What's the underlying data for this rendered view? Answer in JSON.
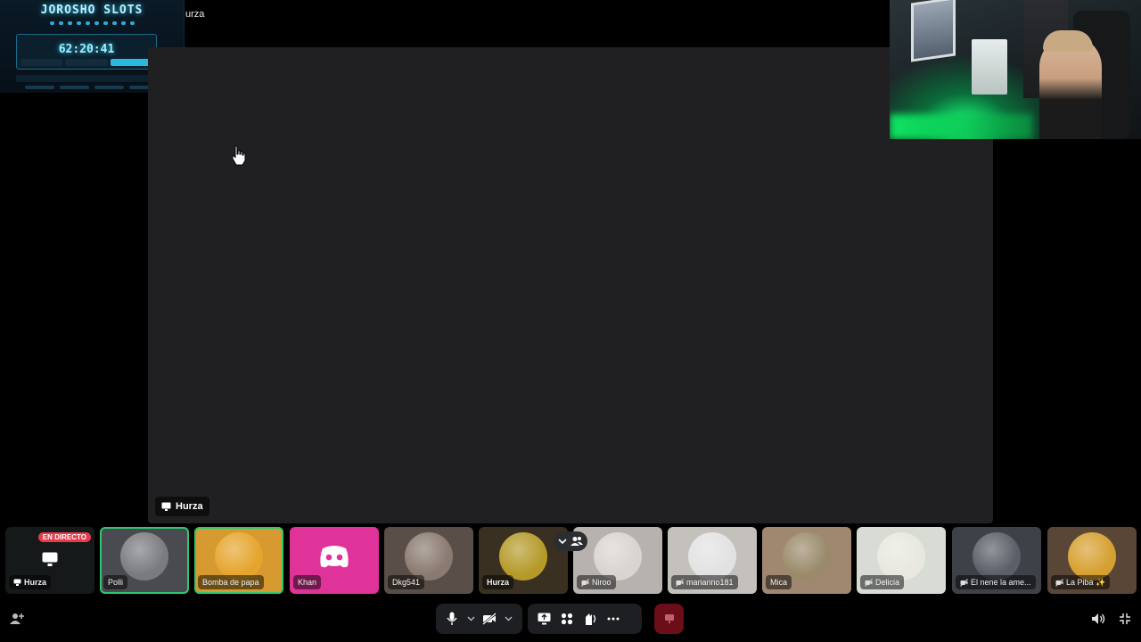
{
  "overlay": {
    "title": "JOROSHO SLOTS",
    "timer": "62:20:41"
  },
  "window": {
    "title": "urza"
  },
  "stage": {
    "streamer_name": "Hurza"
  },
  "participants": [
    {
      "name": "Hurza",
      "live": true,
      "live_label": "EN DIRECTO",
      "avatar_color": "#1a2a26",
      "tile_color": "#15191a"
    },
    {
      "name": "Polli",
      "avatar_color": "#7a7b80",
      "tile_color": "#4a4b50",
      "speaking": true
    },
    {
      "name": "Bomba de papa",
      "avatar_color": "#e5a52d",
      "tile_color": "#d69a30",
      "speaking": true
    },
    {
      "name": "Khan",
      "avatar_color": "#e6399b",
      "tile_color": "#e0339a"
    },
    {
      "name": "Dkg541",
      "avatar_color": "#8a7a70",
      "tile_color": "#5a4e48"
    },
    {
      "name": "Hurza",
      "avatar_color": "#b59a2a",
      "tile_color": "#3a3022"
    },
    {
      "name": "Niroo",
      "muted": true,
      "avatar_color": "#d8d4d0",
      "tile_color": "#b8b2ae"
    },
    {
      "name": "marianno181",
      "muted": true,
      "avatar_color": "#e2e2e2",
      "tile_color": "#c4c0bc"
    },
    {
      "name": "Mica",
      "avatar_color": "#9a8a6a",
      "tile_color": "#a08870"
    },
    {
      "name": "Delicia",
      "muted": true,
      "avatar_color": "#e8e8e0",
      "tile_color": "#d8dcd4"
    },
    {
      "name": "El nene la ame...",
      "muted": true,
      "avatar_color": "#5a5e66",
      "tile_color": "#3e4148"
    },
    {
      "name": "La Piba ✨",
      "muted": true,
      "avatar_color": "#d6a030",
      "tile_color": "#5a4636"
    }
  ],
  "colors": {
    "background": "#000000",
    "stage": "#202022",
    "control_bar": "#1e1f22",
    "end_call": "#6b0e17",
    "speaking_ring": "#2dc770",
    "live_badge": "#e63c4a"
  },
  "controls": {
    "icons": [
      "add-friend-icon",
      "microphone-icon",
      "chevron-down-icon",
      "camera-off-icon",
      "chevron-down-icon",
      "screen-share-icon",
      "activities-icon",
      "soundboard-icon",
      "more-icon",
      "disconnect-icon",
      "volume-icon",
      "exit-fullscreen-icon"
    ]
  }
}
